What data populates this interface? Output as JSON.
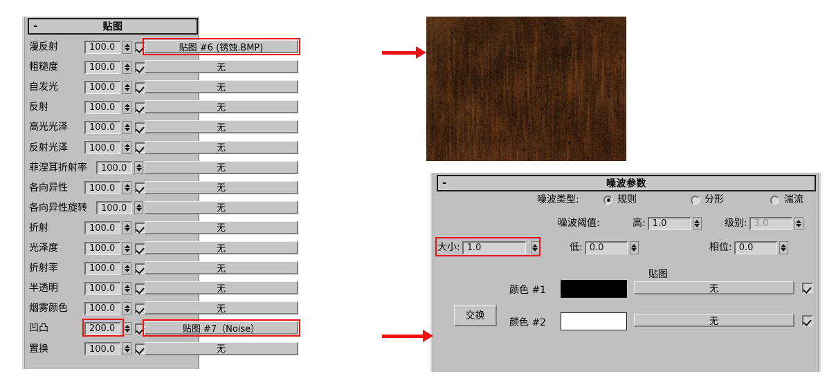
{
  "maps_panel": {
    "title": "贴图",
    "collapse_glyph": "-",
    "none_label": "无",
    "rows": [
      {
        "label": "漫反射",
        "amount": "100.0",
        "checked": true,
        "map": "贴图 #6 (锈蚀.BMP)",
        "highlight_amount": false,
        "highlight_map": true,
        "wide_label": false
      },
      {
        "label": "粗糙度",
        "amount": "100.0",
        "checked": true,
        "map": "无",
        "highlight_amount": false,
        "highlight_map": false,
        "wide_label": false
      },
      {
        "label": "自发光",
        "amount": "100.0",
        "checked": true,
        "map": "无",
        "highlight_amount": false,
        "highlight_map": false,
        "wide_label": false
      },
      {
        "label": "反射",
        "amount": "100.0",
        "checked": true,
        "map": "无",
        "highlight_amount": false,
        "highlight_map": false,
        "wide_label": false
      },
      {
        "label": "高光光泽",
        "amount": "100.0",
        "checked": true,
        "map": "无",
        "highlight_amount": false,
        "highlight_map": false,
        "wide_label": false
      },
      {
        "label": "反射光泽",
        "amount": "100.0",
        "checked": true,
        "map": "无",
        "highlight_amount": false,
        "highlight_map": false,
        "wide_label": false
      },
      {
        "label": "菲涅耳折射率",
        "amount": "100.0",
        "checked": true,
        "map": "无",
        "highlight_amount": false,
        "highlight_map": false,
        "wide_label": true
      },
      {
        "label": "各向异性",
        "amount": "100.0",
        "checked": true,
        "map": "无",
        "highlight_amount": false,
        "highlight_map": false,
        "wide_label": false
      },
      {
        "label": "各向异性旋转",
        "amount": "100.0",
        "checked": true,
        "map": "无",
        "highlight_amount": false,
        "highlight_map": false,
        "wide_label": true
      },
      {
        "label": "折射",
        "amount": "100.0",
        "checked": true,
        "map": "无",
        "highlight_amount": false,
        "highlight_map": false,
        "wide_label": false
      },
      {
        "label": "光泽度",
        "amount": "100.0",
        "checked": true,
        "map": "无",
        "highlight_amount": false,
        "highlight_map": false,
        "wide_label": false
      },
      {
        "label": "折射率",
        "amount": "100.0",
        "checked": true,
        "map": "无",
        "highlight_amount": false,
        "highlight_map": false,
        "wide_label": false
      },
      {
        "label": "半透明",
        "amount": "100.0",
        "checked": true,
        "map": "无",
        "highlight_amount": false,
        "highlight_map": false,
        "wide_label": false
      },
      {
        "label": "烟雾颜色",
        "amount": "100.0",
        "checked": true,
        "map": "无",
        "highlight_amount": false,
        "highlight_map": false,
        "wide_label": false
      },
      {
        "label": "凹凸",
        "amount": "200.0",
        "checked": true,
        "map": "贴图 #7（Noise）",
        "highlight_amount": true,
        "highlight_map": true,
        "wide_label": false
      },
      {
        "label": "置换",
        "amount": "100.0",
        "checked": true,
        "map": "无",
        "highlight_amount": false,
        "highlight_map": false,
        "wide_label": false
      }
    ]
  },
  "texture_preview": {
    "name": "锈蚀.BMP",
    "base_color": "#6b3a1e"
  },
  "noise_panel": {
    "title": "噪波参数",
    "collapse_glyph": "-",
    "noise_type_label": "噪波类型:",
    "noise_types": [
      {
        "label": "规则",
        "selected": true
      },
      {
        "label": "分形",
        "selected": false
      },
      {
        "label": "湍流",
        "selected": false
      }
    ],
    "threshold_label": "噪波阈值:",
    "high_label": "高:",
    "high_value": "1.0",
    "levels_label": "级别:",
    "levels_value": "3.0",
    "levels_disabled": true,
    "size_label": "大小:",
    "size_value": "1.0",
    "size_highlighted": true,
    "low_label": "低:",
    "low_value": "0.0",
    "phase_label": "相位:",
    "phase_value": "0.0",
    "maps_header": "贴图",
    "swap_label": "交换",
    "color1_label": "颜色 #1",
    "color1_value": "#000000",
    "color1_map": "无",
    "color1_map_checked": true,
    "color2_label": "颜色 #2",
    "color2_value": "#ffffff",
    "color2_map": "无",
    "color2_map_checked": true
  },
  "annotations": {
    "highlight_color": "#ef1010",
    "arrow_count": 2
  }
}
